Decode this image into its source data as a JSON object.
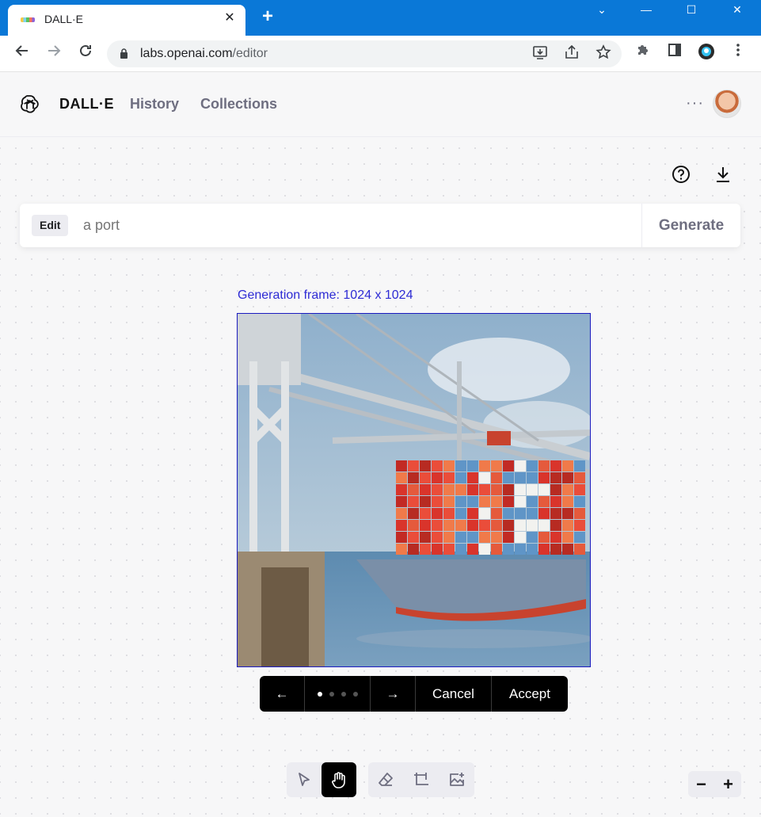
{
  "browser": {
    "tab_title": "DALL·E",
    "tab_close": "✕",
    "new_tab": "+",
    "url_host": "labs.openai.com",
    "url_path": "/editor",
    "window_controls": {
      "collapse": "⌄",
      "minimize": "—",
      "maximize": "☐",
      "close": "✕"
    }
  },
  "header": {
    "brand": "DALL·E",
    "nav": [
      "History",
      "Collections"
    ],
    "more": "···"
  },
  "prompt": {
    "mode_chip": "Edit",
    "placeholder": "a port",
    "generate_label": "Generate"
  },
  "canvas": {
    "frame_label": "Generation frame: 1024 x 1024",
    "image_description_icon": "generated-image"
  },
  "variations": {
    "prev": "←",
    "next": "→",
    "count": 4,
    "active_index": 0,
    "cancel_label": "Cancel",
    "accept_label": "Accept"
  },
  "tools": {
    "active": "hand-tool",
    "items": [
      "select-tool",
      "hand-tool",
      "eraser-tool",
      "add-frame-tool",
      "upload-image-tool"
    ]
  },
  "zoom": {
    "out": "−",
    "in": "+"
  },
  "colors": {
    "accent": "#2d2bd4",
    "chrome": "#0a78d7",
    "pill": "#000000"
  }
}
